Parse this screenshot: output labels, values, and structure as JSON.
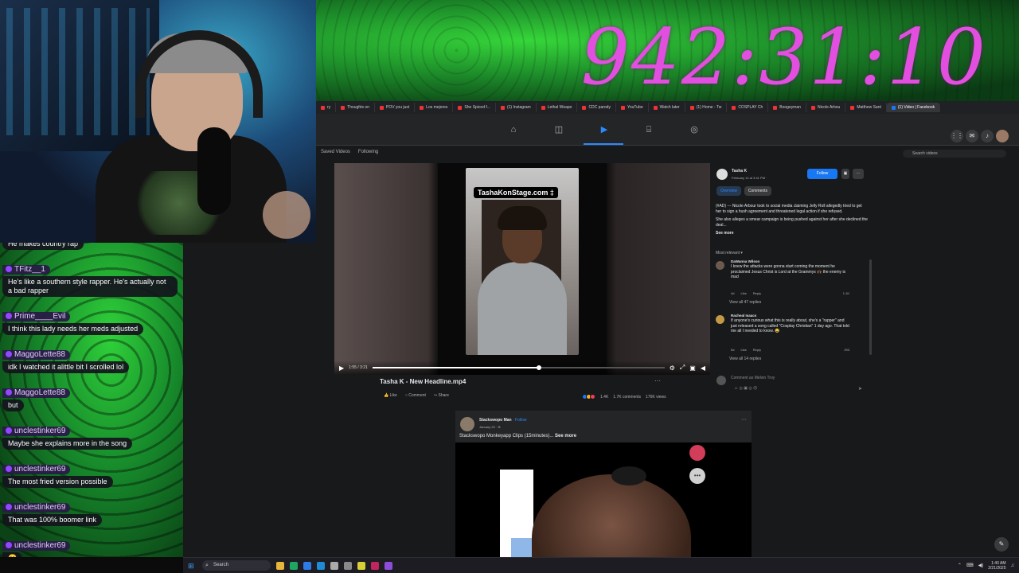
{
  "timer": "942:31:10",
  "browser_tabs": [
    {
      "label": "ry"
    },
    {
      "label": "Thoughts on"
    },
    {
      "label": "POV you just"
    },
    {
      "label": "Los mejores"
    },
    {
      "label": "She Spiced f..."
    },
    {
      "label": "(1) Instagram"
    },
    {
      "label": "Lethal Weapo"
    },
    {
      "label": "CDC parody"
    },
    {
      "label": "YouTube"
    },
    {
      "label": "Watch later"
    },
    {
      "label": "(1) Home - Tw"
    },
    {
      "label": "COSPLAY Ch"
    },
    {
      "label": "Boogeyman"
    },
    {
      "label": "Nicole Arbou"
    },
    {
      "label": "Matthew Sant"
    },
    {
      "label": "(1) Video | Facebook"
    }
  ],
  "watch": {
    "tab_saved": "Saved Videos",
    "tab_following": "Following",
    "search_placeholder": "Search videos",
    "video_overlay_text": "TashaKonStage.com ‡",
    "video_time": "1:55 / 3:21",
    "video_progress": 0.57,
    "video_title": "Tasha K - New Headline.mp4",
    "video_more": "···",
    "actions": {
      "like": "Like",
      "comment": "Comment",
      "share": "Share"
    },
    "stats": {
      "reactions": "1.4K",
      "comments": "1.7K comments",
      "views": "176K views"
    }
  },
  "info": {
    "author": "Tasha K",
    "date": "February 14 at 3:41 PM ·",
    "follow": "Follow",
    "more1": "▣",
    "more2": "···",
    "tab_overview": "Overview",
    "tab_comments": "Comments",
    "post_p1": "(#AD) --- Nicole Arbour took to social media claiming Jelly Roll allegedly tried to get her to sign a hush agreement and threatened legal action if she refused.",
    "post_p2": "She also alleges a smear campaign is being pushed against her after she declined the deal...",
    "see_more": "See more",
    "most_relevant": "Most relevant ▾",
    "comments": [
      {
        "name": "DaWanna Wilson",
        "body": "I knew the attacks were gonna start coming the moment he proclaimed Jesus Christ is Lord at the Grammys 🙌🏾 the enemy is mad",
        "time": "4d",
        "like": "Like",
        "reply": "Reply",
        "count": "1.1K",
        "replies": "View all 47 replies"
      },
      {
        "name": "Racheal Isaacs",
        "body": "If anyone's curious what this is really about, she's a \"rapper\" and just released a song called \"Cosplay Christian\" 1 day ago. That told me all I needed to know. 😂",
        "time": "5d",
        "like": "Like",
        "reply": "Reply",
        "count": "293",
        "replies": "View all 14 replies"
      }
    ],
    "comment_placeholder": "Comment as Melvin Troy",
    "comment_tools": "☺ ◎ ▣ ◎ ☹",
    "send_icon": "➤"
  },
  "post2": {
    "author": "Stackswopo Man",
    "follow": " · Follow",
    "date": "January 20 · ⊕",
    "text": "Stackswopo Monkeyapp Clips (15minutes)...",
    "see_more": " See more",
    "more": "···"
  },
  "chat": [
    {
      "type": "msg",
      "text": "He makes country rap"
    },
    {
      "type": "name",
      "text": "TFitz__1"
    },
    {
      "type": "msg",
      "text": "He's like a southern style rapper. He's actually not a bad rapper"
    },
    {
      "type": "name",
      "text": "Prime____Evil"
    },
    {
      "type": "msg",
      "text": "I think this lady needs her meds adjusted"
    },
    {
      "type": "name",
      "text": "MaggoLette88"
    },
    {
      "type": "msg",
      "text": "idk I watched it alittle bit I scrolled lol"
    },
    {
      "type": "name",
      "text": "MaggoLette88"
    },
    {
      "type": "msg",
      "text": "but"
    },
    {
      "type": "name",
      "text": "unclestinker69"
    },
    {
      "type": "msg",
      "text": "Maybe she explains more in the song"
    },
    {
      "type": "name",
      "text": "unclestinker69"
    },
    {
      "type": "msg",
      "text": "The most fried version possible"
    },
    {
      "type": "name",
      "text": "unclestinker69"
    },
    {
      "type": "msg",
      "text": "That was 100% boomer link"
    },
    {
      "type": "name",
      "text": "unclestinker69"
    },
    {
      "type": "msg",
      "text": "😕"
    }
  ],
  "taskbar": {
    "search": "Search",
    "clock_time": "1:40 AM",
    "clock_date": "2/21/2025"
  }
}
